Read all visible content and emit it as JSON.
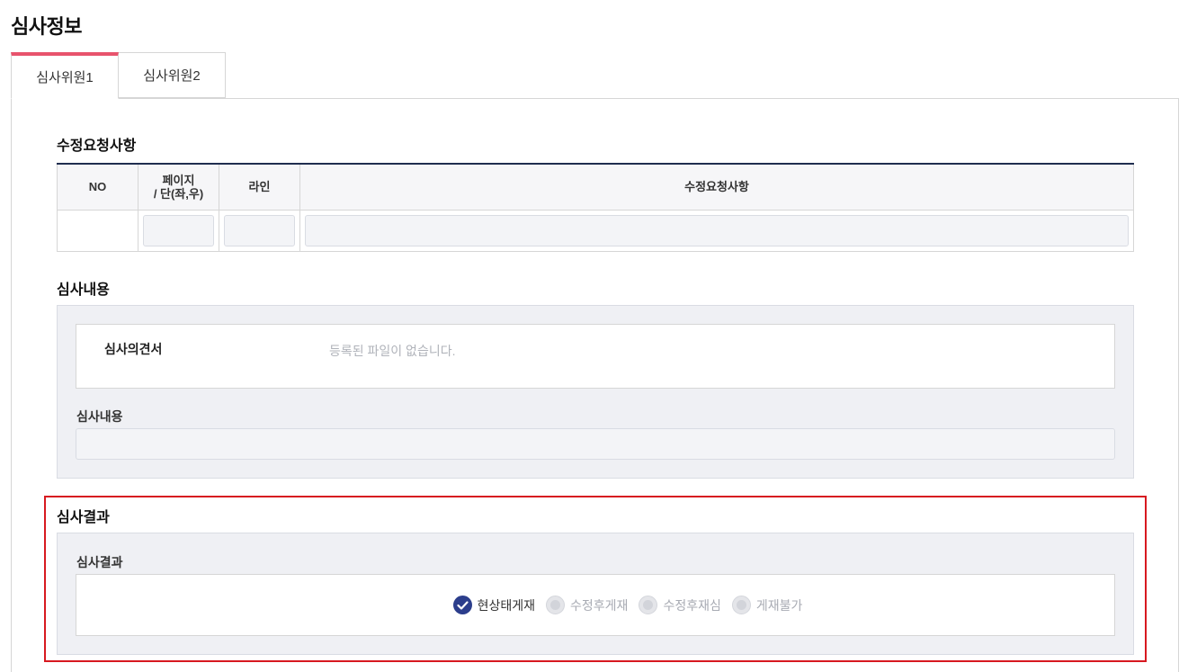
{
  "page": {
    "title": "심사정보"
  },
  "tabs": [
    {
      "label": "심사위원1",
      "active": true
    },
    {
      "label": "심사위원2",
      "active": false
    }
  ],
  "revision": {
    "title": "수정요청사항",
    "columns": [
      "NO",
      "페이지\n/ 단(좌,우)",
      "라인",
      "수정요청사항"
    ],
    "rows": [
      {
        "no": "",
        "page": "",
        "line": "",
        "request": ""
      }
    ]
  },
  "review_content": {
    "title": "심사내용",
    "opinion_label": "심사의견서",
    "opinion_empty_text": "등록된 파일이 없습니다.",
    "content_label": "심사내용",
    "content_value": ""
  },
  "review_result": {
    "title": "심사결과",
    "field_label": "심사결과",
    "options": [
      {
        "label": "현상태게재",
        "checked": true
      },
      {
        "label": "수정후게재",
        "checked": false
      },
      {
        "label": "수정후재심",
        "checked": false
      },
      {
        "label": "게재불가",
        "checked": false
      }
    ]
  },
  "colors": {
    "tab_accent": "#e8536d",
    "radio_checked": "#2c3e8c",
    "highlight": "#d71920",
    "table_header_rule": "#1f2d4f"
  }
}
